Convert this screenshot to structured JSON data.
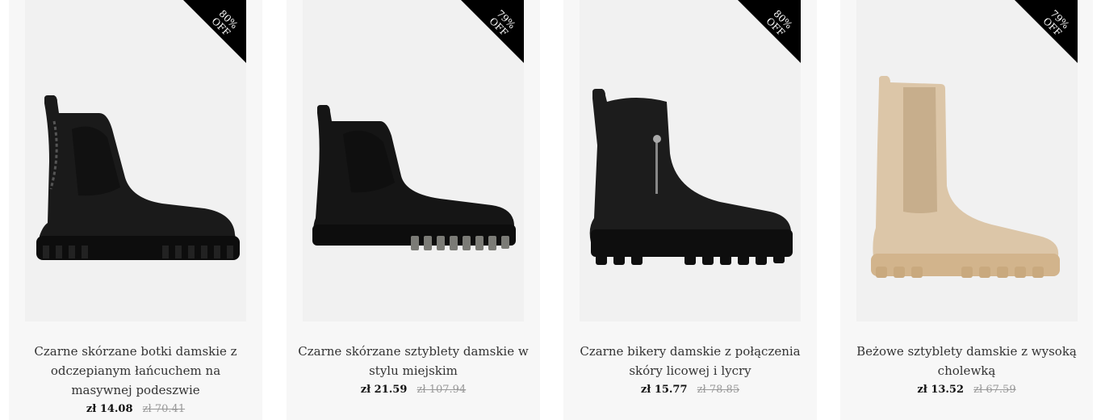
{
  "products": [
    {
      "badge_percent": "80%",
      "badge_off": "OFF",
      "title": "Czarne skórzane botki damskie z odczepianym łańcuchem na masywnej podeszwie",
      "price_new": "zł 14.08",
      "price_old": "zł 70.41",
      "image_icon": "black-chelsea-boot-with-chain-icon",
      "color": "#1a1a1a"
    },
    {
      "badge_percent": "79%",
      "badge_off": "OFF",
      "title": "Czarne skórzane sztyblety damskie w stylu miejskim",
      "price_new": "zł 21.59",
      "price_old": "zł 107.94",
      "image_icon": "black-suede-chelsea-boot-icon",
      "color": "#151515"
    },
    {
      "badge_percent": "80%",
      "badge_off": "OFF",
      "title": "Czarne bikery damskie z połączenia skóry licowej i lycry",
      "price_new": "zł 15.77",
      "price_old": "zł 78.85",
      "image_icon": "black-biker-boot-icon",
      "color": "#1c1c1c"
    },
    {
      "badge_percent": "79%",
      "badge_off": "OFF",
      "title": "Beżowe sztyblety damskie z wysoką cholewką",
      "price_new": "zł 13.52",
      "price_old": "zł 67.59",
      "image_icon": "beige-high-chelsea-boot-icon",
      "color": "#dcc6a8"
    }
  ]
}
